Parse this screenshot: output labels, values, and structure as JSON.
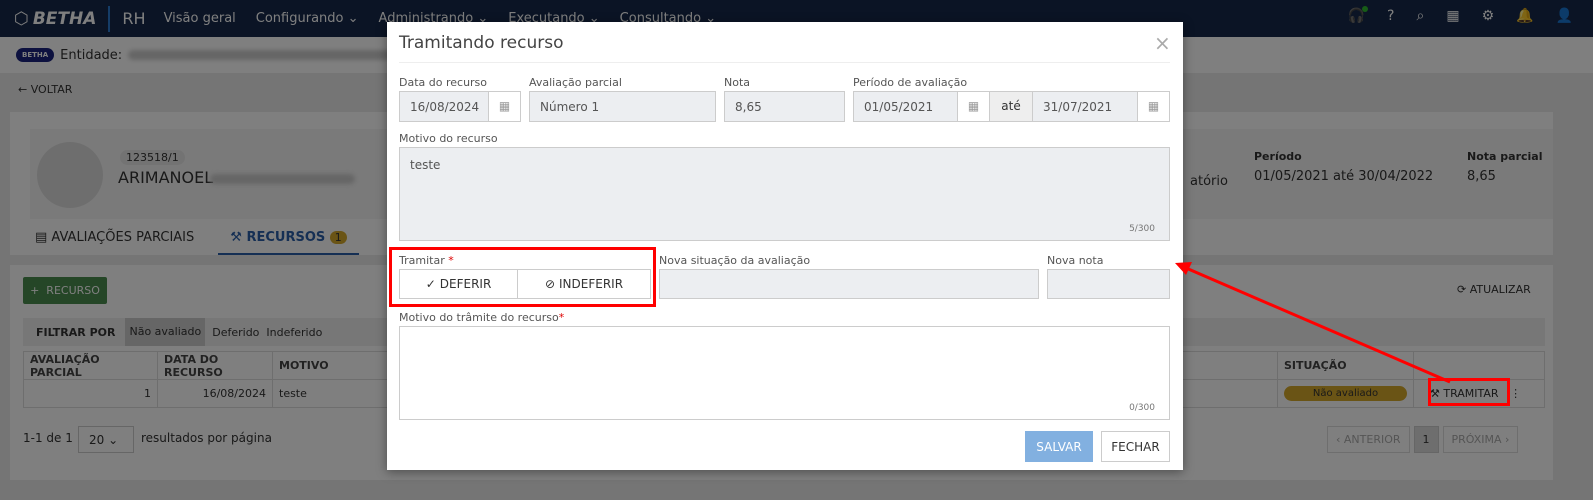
{
  "nav": {
    "brand": "BETHA",
    "module": "RH",
    "menu": [
      {
        "label": "Visão geral"
      },
      {
        "label": "Configurando"
      },
      {
        "label": "Administrando"
      },
      {
        "label": "Executando"
      },
      {
        "label": "Consultando"
      }
    ],
    "icons": [
      "headset-icon",
      "help-icon",
      "search-icon",
      "apps-grid-icon",
      "settings-icon",
      "bell-icon",
      "user-icon"
    ],
    "online_color": "#2eb82e"
  },
  "entity": {
    "label": "Entidade:"
  },
  "back": {
    "label": "VOLTAR"
  },
  "profile": {
    "code": "123518/1",
    "name": "ARIMANOEL",
    "partial_text": "atório",
    "period_label": "Período",
    "period_value": "01/05/2021 até 30/04/2022",
    "grade_label": "Nota parcial",
    "grade_value": "8,65"
  },
  "tabs": [
    {
      "label": "AVALIAÇÕES PARCIAIS"
    },
    {
      "label": "RECURSOS",
      "badge": "1"
    }
  ],
  "toolbar": {
    "add_label": "RECURSO",
    "refresh_label": "ATUALIZAR"
  },
  "filter": {
    "label": "FILTRAR POR",
    "options": [
      "Não avaliado",
      "Deferido",
      "Indeferido"
    ],
    "selected": "Não avaliado"
  },
  "table": {
    "headers": [
      "AVALIAÇÃO PARCIAL",
      "DATA DO RECURSO",
      "MOTIVO",
      "SITUAÇÃO",
      ""
    ],
    "rows": [
      {
        "avaliacao": "1",
        "data": "16/08/2024",
        "motivo": "teste",
        "situacao": "Não avaliado",
        "action": "TRAMITAR"
      }
    ],
    "status_color": "#d4a82a"
  },
  "pagination": {
    "summary": "1-1 de 1",
    "page_size": "20",
    "page_size_label": "resultados por página",
    "prev": "ANTERIOR",
    "page": "1",
    "next": "PRÓXIMA"
  },
  "modal": {
    "title": "Tramitando recurso",
    "fields": {
      "data_label": "Data do recurso",
      "data_value": "16/08/2024",
      "aval_label": "Avaliação parcial",
      "aval_value": "Número 1",
      "nota_label": "Nota",
      "nota_value": "8,65",
      "periodo_label": "Período de avaliação",
      "periodo_start": "01/05/2021",
      "ate": "até",
      "periodo_end": "31/07/2021"
    },
    "motivo_label": "Motivo do recurso",
    "motivo_value": "teste",
    "motivo_count": "5/300",
    "tramitar_label": "Tramitar",
    "deferir": "DEFERIR",
    "indeferir": "INDEFERIR",
    "nova_situacao_label": "Nova situação da avaliação",
    "nova_nota_label": "Nova nota",
    "motivo_tramite_label": "Motivo do trâmite do recurso",
    "motivo_tramite_count": "0/300",
    "save": "SALVAR",
    "close": "FECHAR"
  },
  "annotation_color": "#ff0000"
}
